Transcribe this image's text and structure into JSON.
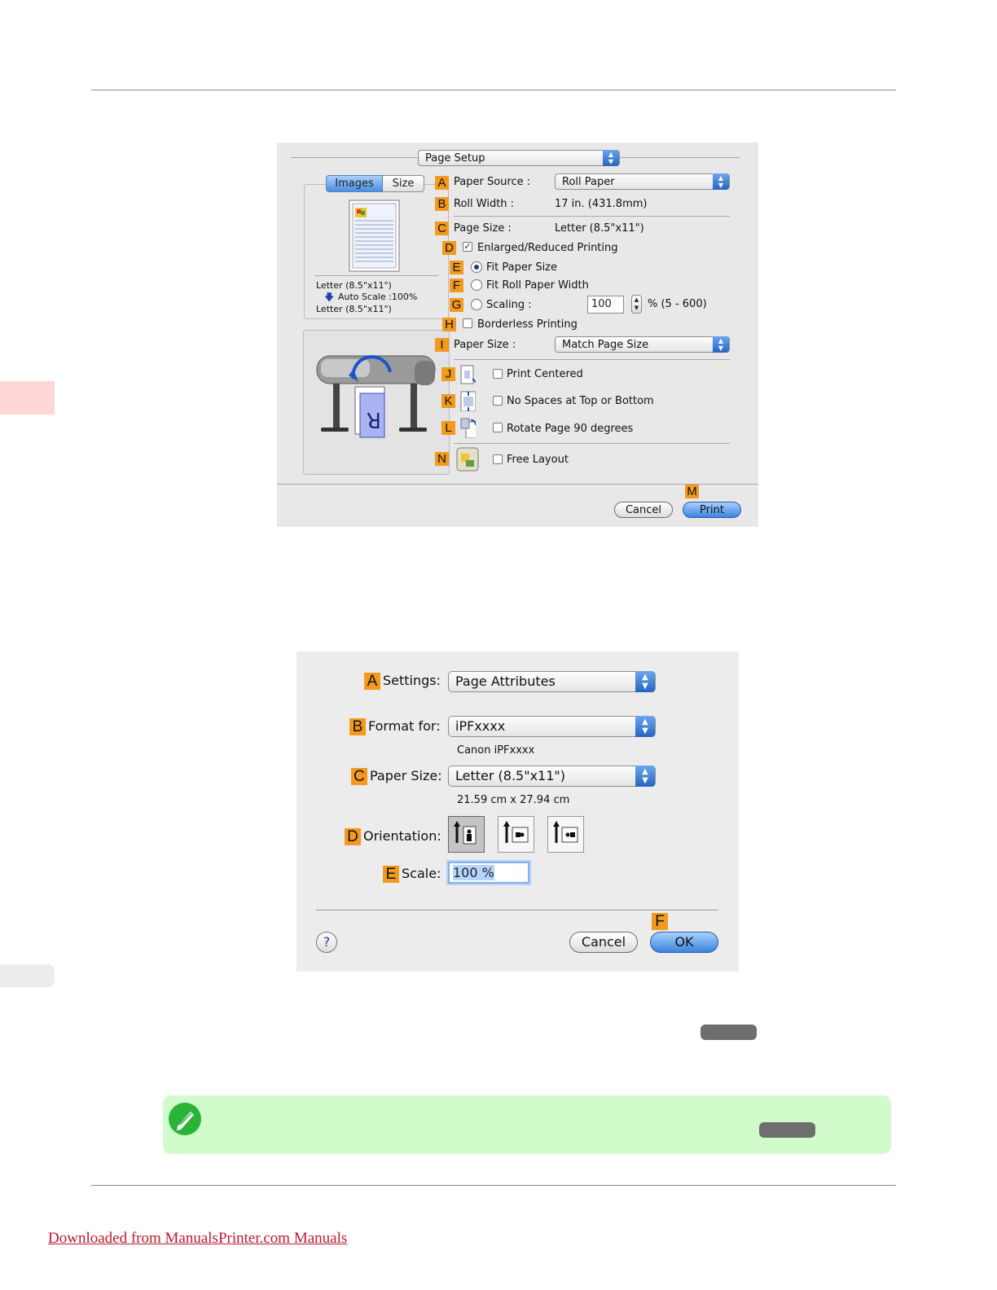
{
  "dialog1": {
    "title_popup": "Page Setup",
    "tabs": [
      "Images",
      "Size"
    ],
    "preview": {
      "line1": "Letter (8.5\"x11\")",
      "line2": "Auto Scale :100%",
      "line3": "Letter (8.5\"x11\")"
    },
    "badges": {
      "A": "A",
      "B": "B",
      "C": "C",
      "D": "D",
      "E": "E",
      "F": "F",
      "G": "G",
      "H": "H",
      "I": "I",
      "J": "J",
      "K": "K",
      "L": "L",
      "M": "M",
      "N": "N"
    },
    "paper_source_label": "Paper Source :",
    "paper_source_value": "Roll Paper",
    "roll_width_label": "Roll Width :",
    "roll_width_value": "17 in. (431.8mm)",
    "page_size_label": "Page Size :",
    "page_size_value": "Letter (8.5\"x11\")",
    "enlarged_label": "Enlarged/Reduced Printing",
    "enlarged_checked": true,
    "fit_paper_label": "Fit Paper Size",
    "fit_roll_label": "Fit Roll Paper Width",
    "scaling_label": "Scaling :",
    "scaling_value": "100",
    "scaling_range": "% (5 - 600)",
    "borderless_label": "Borderless Printing",
    "paper_size_label": "Paper Size :",
    "paper_size_value": "Match Page Size",
    "print_centered_label": "Print Centered",
    "no_spaces_label": "No Spaces at Top or Bottom",
    "rotate_label": "Rotate Page 90 degrees",
    "free_layout_label": "Free Layout",
    "cancel_label": "Cancel",
    "print_label": "Print"
  },
  "dialog2": {
    "badges": {
      "A": "A",
      "B": "B",
      "C": "C",
      "D": "D",
      "E": "E",
      "F": "F"
    },
    "settings_label": "Settings:",
    "settings_value": "Page Attributes",
    "format_label": "Format for:",
    "format_value": "iPFxxxx",
    "format_sub": "Canon iPFxxxx",
    "paper_size_label": "Paper Size:",
    "paper_size_value": "Letter (8.5\"x11\")",
    "paper_size_sub": "21.59 cm x 27.94 cm",
    "orientation_label": "Orientation:",
    "scale_label": "Scale:",
    "scale_value": "100 %",
    "help_label": "?",
    "cancel_label": "Cancel",
    "ok_label": "OK"
  },
  "footer": {
    "link_text": "Downloaded from ManualsPrinter.com Manuals"
  },
  "colors": {
    "badge": "#f39a1e",
    "note_bg": "#d1fbcb",
    "side_tab_pink": "#ffd6d6",
    "footer_link": "#c0182e"
  }
}
